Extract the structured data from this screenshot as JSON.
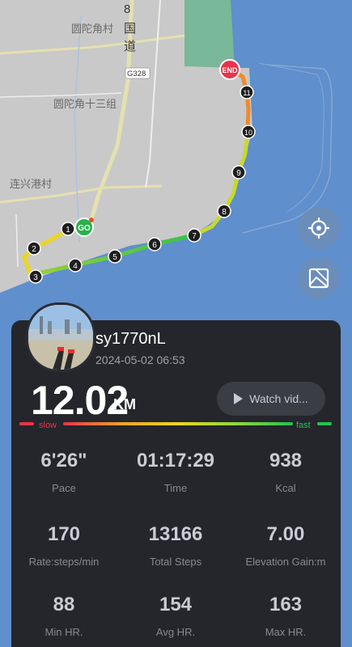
{
  "map": {
    "place_labels": [
      "圆陀角村",
      "圆陀角十三组",
      "连兴港村"
    ],
    "road_label_vertical": [
      "8",
      "国",
      "道"
    ],
    "road_badge": "G328",
    "start_marker": "GO",
    "end_marker": "END",
    "km_markers": [
      "1",
      "2",
      "3",
      "4",
      "5",
      "6",
      "7",
      "8",
      "9",
      "10",
      "11"
    ],
    "locate_button_icon": "crosshair-icon",
    "map_toggle_icon": "image-frame-icon",
    "colors": {
      "land": "#c9c9c9",
      "sea": "#5f8fcc",
      "park": "#79b898",
      "route_fast": "#27c04e",
      "route_slow": "#e8344b"
    }
  },
  "profile": {
    "username": "sy1770nL",
    "datetime": "2024-05-02 06:53"
  },
  "summary": {
    "distance": "12.02",
    "unit": "KM",
    "video_button": "Watch vid..."
  },
  "pace_legend": {
    "slow": "slow",
    "fast": "fast"
  },
  "stats": [
    {
      "value": "6'26\"",
      "label": "Pace"
    },
    {
      "value": "01:17:29",
      "label": "Time"
    },
    {
      "value": "938",
      "label": "Kcal"
    },
    {
      "value": "170",
      "label": "Rate:steps/min"
    },
    {
      "value": "13166",
      "label": "Total Steps"
    },
    {
      "value": "7.00",
      "label": "Elevation Gain:m"
    },
    {
      "value": "88",
      "label": "Min HR."
    },
    {
      "value": "154",
      "label": "Avg HR."
    },
    {
      "value": "163",
      "label": "Max HR."
    }
  ]
}
